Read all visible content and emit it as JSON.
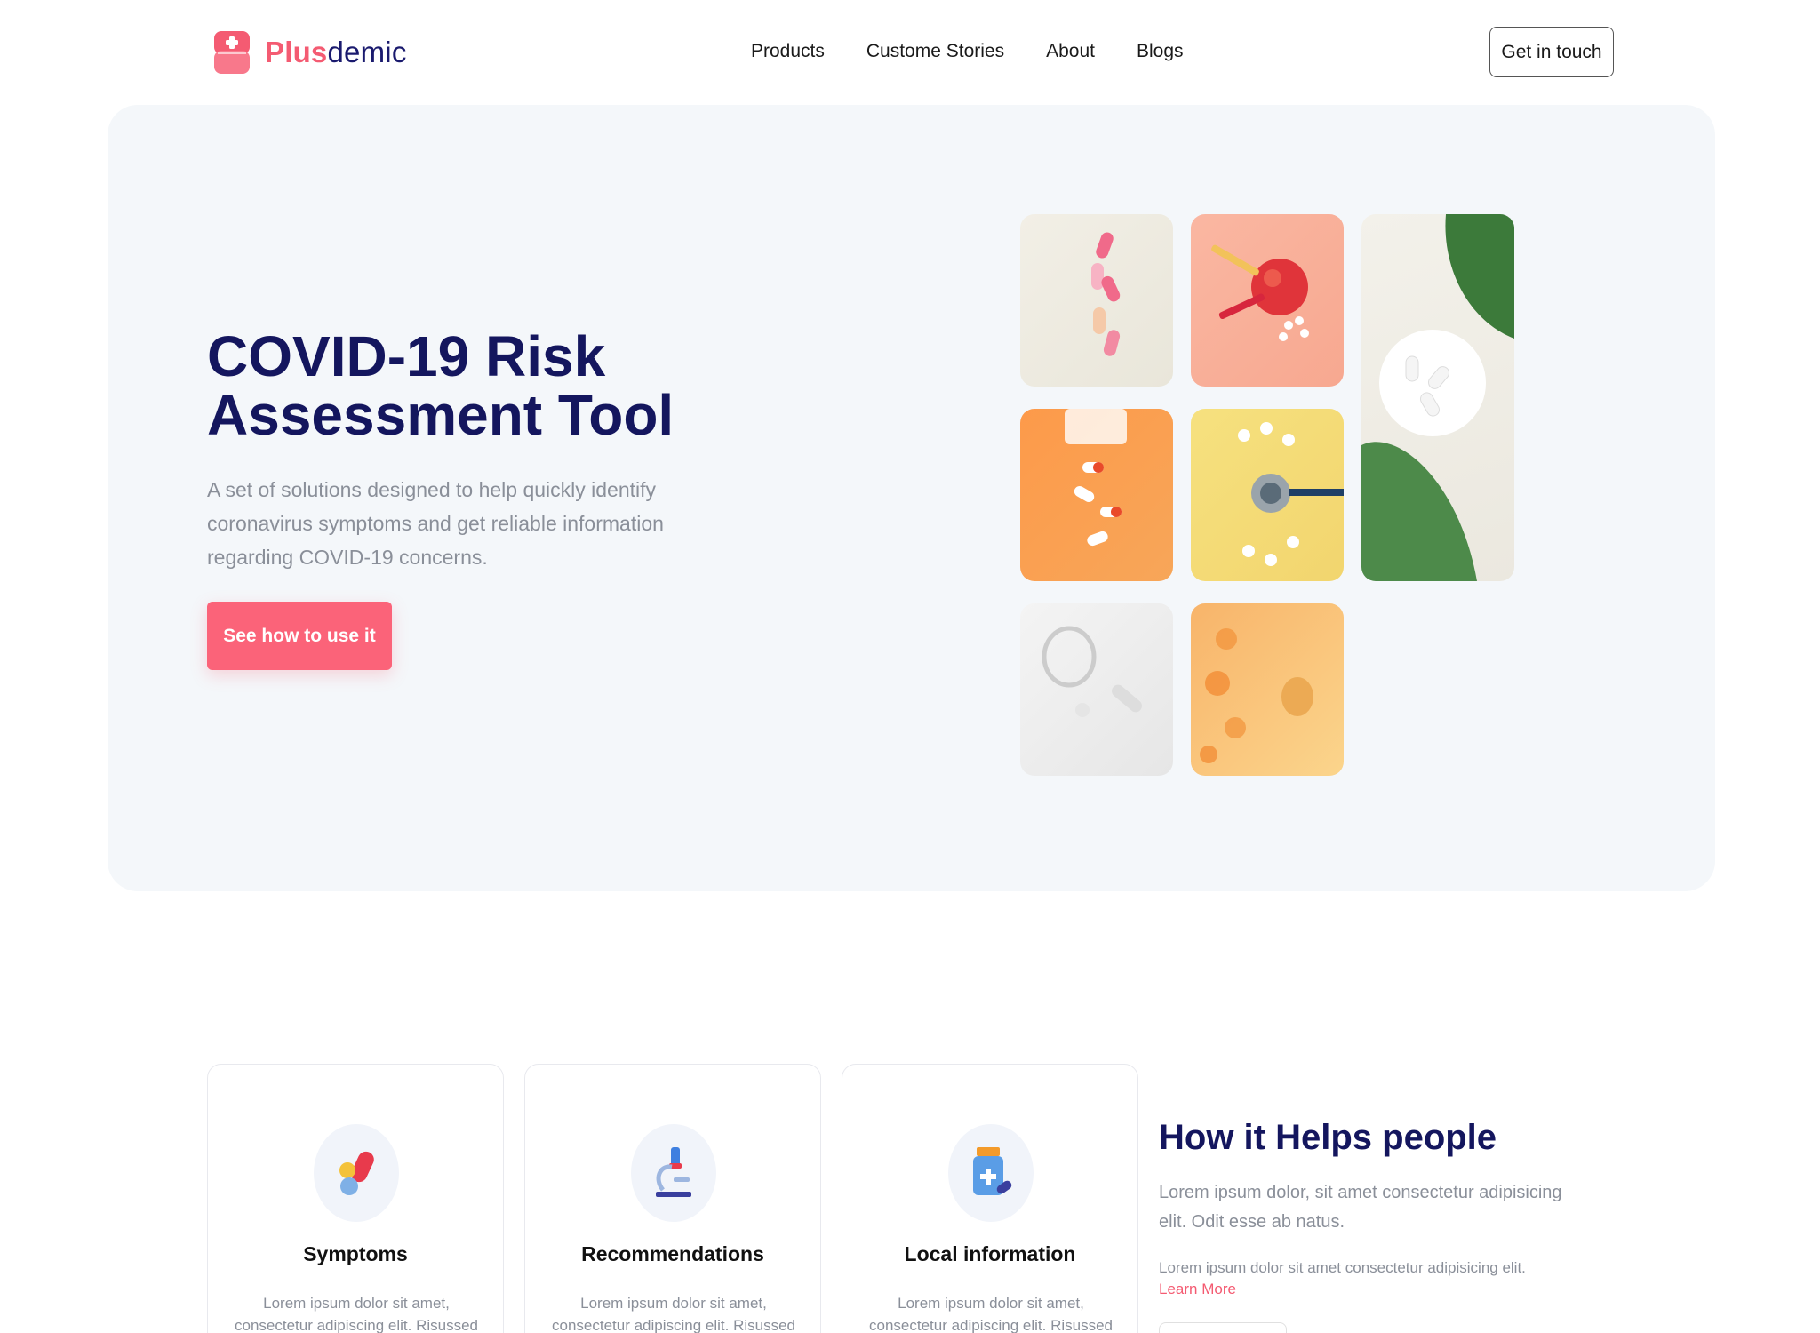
{
  "brand": {
    "name_part1": "Plus",
    "name_part2": "demic",
    "accent": "#f45b72",
    "navy": "#14165e"
  },
  "nav": {
    "links": [
      "Products",
      "Custome Stories",
      "About",
      "Blogs"
    ],
    "cta": "Get in touch"
  },
  "hero": {
    "title_line1": "COVID-19 Risk",
    "title_line2": "Assessment Tool",
    "description": "A set of solutions designed to help quickly identify coronavirus symptoms and get reliable information regarding COVID-19 concerns.",
    "button": "See how to use it"
  },
  "features": [
    {
      "title": "Symptoms",
      "text": "Lorem ipsum dolor sit amet, consectetur adipiscing elit. Risussed",
      "icon": "pills-icon"
    },
    {
      "title": "Recommendations",
      "text": "Lorem ipsum dolor sit amet, consectetur adipiscing elit. Risussed",
      "icon": "microscope-icon"
    },
    {
      "title": "Local information",
      "text": "Lorem ipsum dolor sit amet, consectetur adipiscing elit. Risussed",
      "icon": "medicine-bottle-icon"
    }
  ],
  "help": {
    "title": "How it Helps people",
    "paragraph1": "Lorem ipsum dolor, sit amet consectetur adipisicing elit. Odit esse ab natus.",
    "paragraph2": "Lorem ipsum dolor sit amet consectetur adipisicing elit.",
    "link": "Learn More"
  }
}
